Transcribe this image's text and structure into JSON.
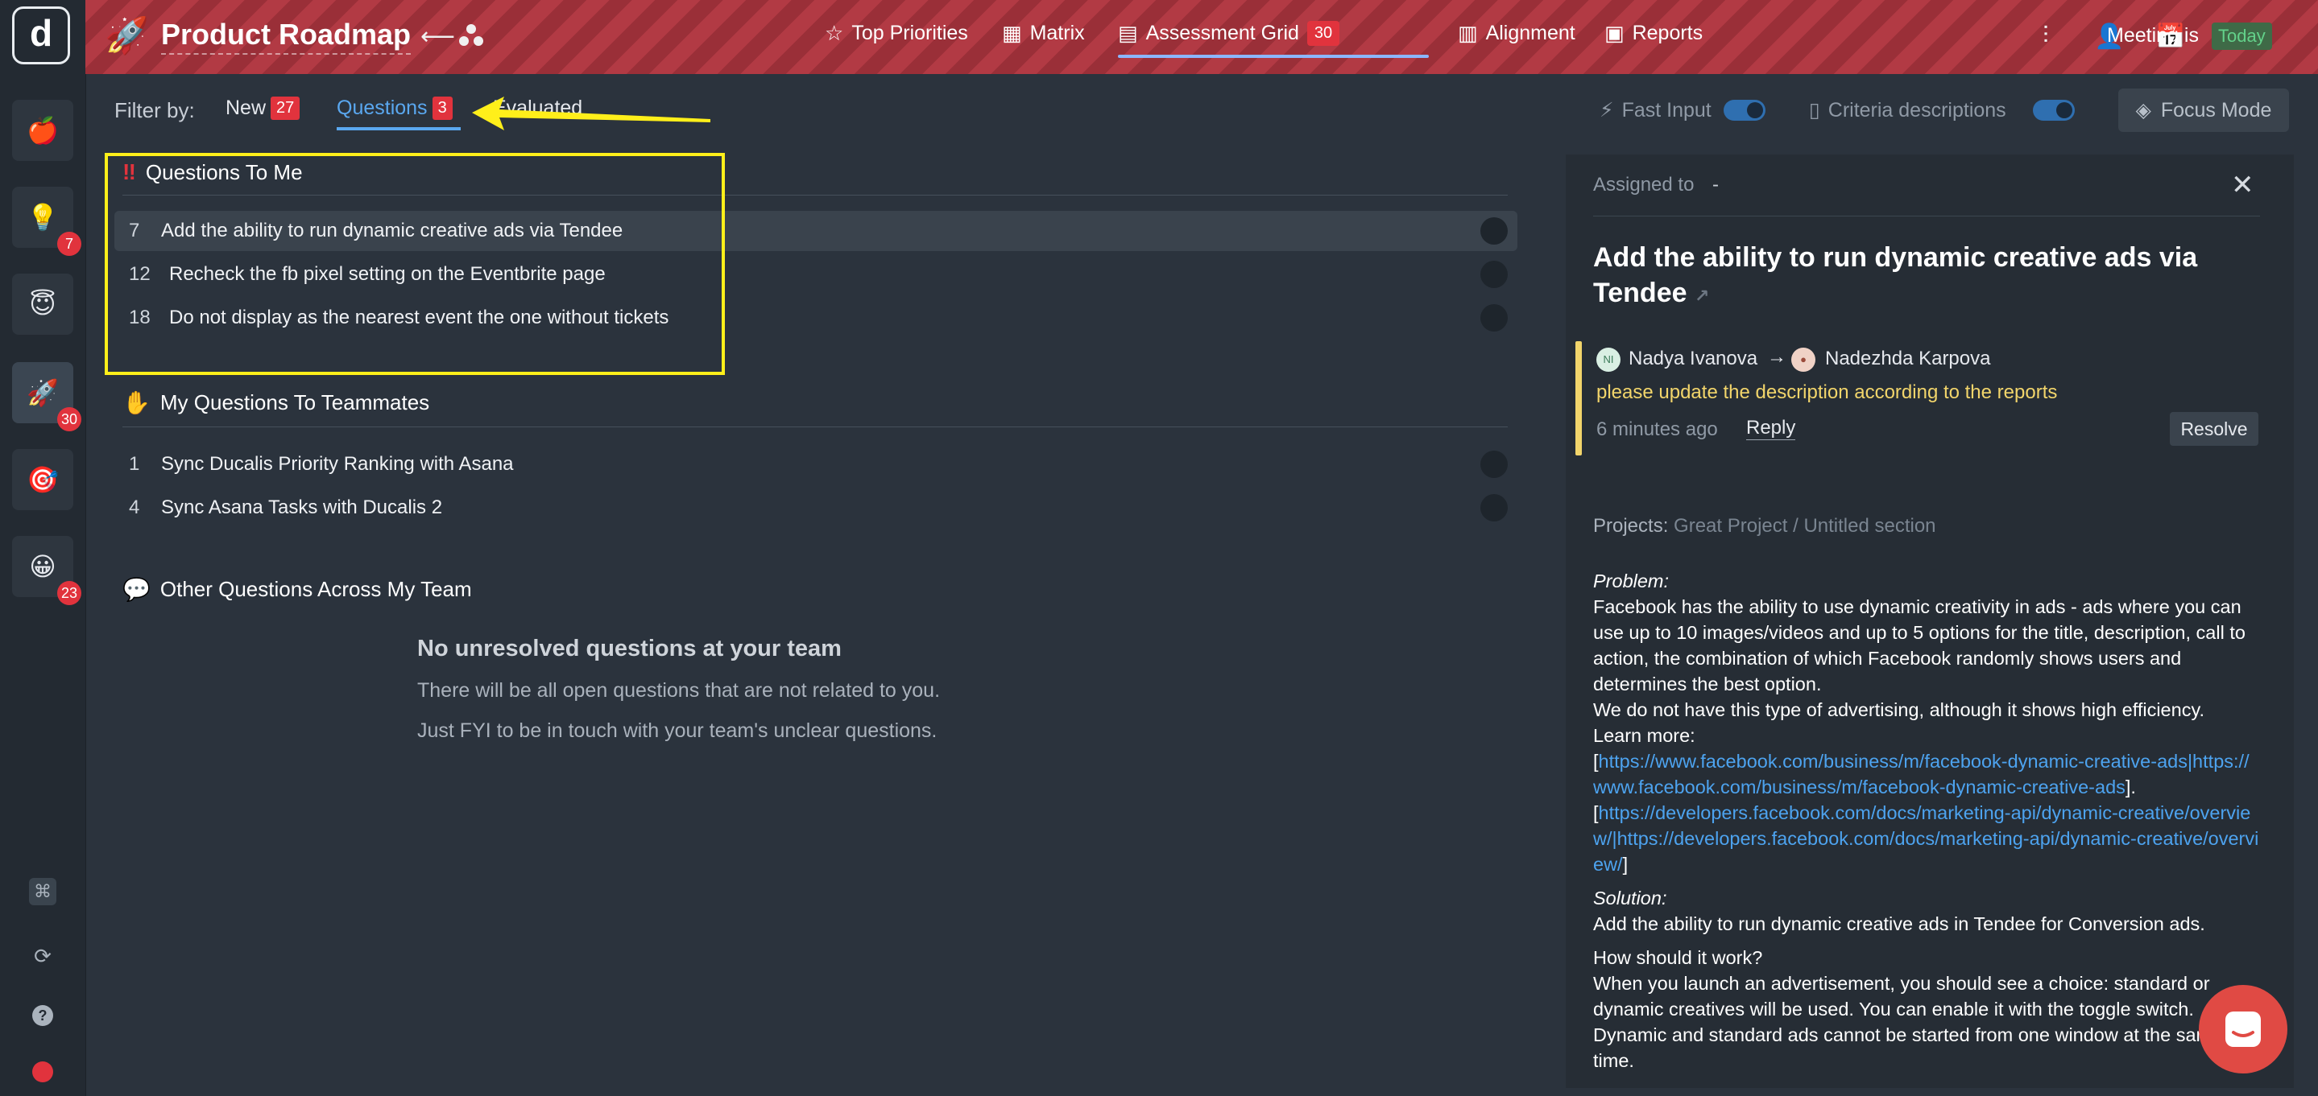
{
  "app": {
    "title": "Product Roadmap"
  },
  "nav": [
    {
      "label": "Top Priorities",
      "icon": "star-icon"
    },
    {
      "label": "Matrix",
      "icon": "grid-icon"
    },
    {
      "label": "Assessment Grid",
      "icon": "table-icon",
      "badge": "30",
      "active": true
    },
    {
      "label": "Alignment",
      "icon": "bar-chart-icon"
    },
    {
      "label": "Reports",
      "icon": "report-icon"
    }
  ],
  "meeting": {
    "label": "Meeting is",
    "value": "Today"
  },
  "rail": {
    "badges": {
      "ideas": "7",
      "roadmap": "30",
      "smile": "23"
    }
  },
  "filter": {
    "label": "Filter by:",
    "tabs": [
      {
        "label": "New",
        "badge": "27"
      },
      {
        "label": "Questions",
        "badge": "3",
        "active": true
      },
      {
        "label": "Evaluated"
      }
    ]
  },
  "toggles": {
    "fast_input": "Fast Input",
    "criteria": "Criteria descriptions",
    "focus_mode": "Focus Mode"
  },
  "sections": {
    "to_me": {
      "title": "Questions To Me",
      "items": [
        {
          "num": "7",
          "text": "Add the ability to run dynamic creative ads via Tendee"
        },
        {
          "num": "12",
          "text": "Recheck the fb pixel setting on the Eventbrite page"
        },
        {
          "num": "18",
          "text": "Do not display as the nearest event the one without tickets"
        }
      ]
    },
    "to_teammates": {
      "title": "My Questions To Teammates",
      "items": [
        {
          "num": "1",
          "text": "Sync Ducalis Priority Ranking with Asana"
        },
        {
          "num": "4",
          "text": "Sync Asana Tasks with Ducalis 2"
        }
      ]
    },
    "other": {
      "title": "Other Questions Across My Team",
      "empty_title": "No unresolved questions at your team",
      "empty_line1": "There will be all open questions that are not related to you.",
      "empty_line2": "Just FYI to be in touch with your team's unclear questions."
    }
  },
  "panel": {
    "assigned_label": "Assigned to",
    "assigned_value": "-",
    "title": "Add the ability to run dynamic creative ads via Tendee",
    "comment": {
      "from": "Nadya Ivanova",
      "from_initials": "NI",
      "to": "Nadezhda Karpova",
      "text": "please update the description according to the reports",
      "time": "6 minutes ago",
      "reply": "Reply",
      "resolve": "Resolve"
    },
    "projects_label": "Projects:",
    "projects_value": "Great Project / Untitled section",
    "problem_label": "Problem",
    "problem_text": "Facebook has the ability to use dynamic creativity in ads - ads where you can use up to 10 images/videos and up to 5 options for the title, description, call to action, the combination of which Facebook randomly shows users and determines the best option.",
    "problem_text2": "We do not have this type of advertising, although it shows high efficiency.",
    "learn_more": "Learn more:",
    "link1": "https://www.facebook.com/business/m/facebook-dynamic-creative-ads|https://www.facebook.com/business/m/facebook-dynamic-creative-ads",
    "link2": "https://developers.facebook.com/docs/marketing-api/dynamic-creative/overview/|https://developers.facebook.com/docs/marketing-api/dynamic-creative/overview/",
    "solution_label": "Solution",
    "solution_text": "Add the ability to run dynamic creative ads in Tendee for Conversion ads.",
    "how_label": "How should it work?",
    "how_text": "When you launch an advertisement, you should see a choice: standard or dynamic creatives will be used. You can enable it with the toggle switch. Dynamic and standard ads cannot be started from one window at the same time."
  }
}
